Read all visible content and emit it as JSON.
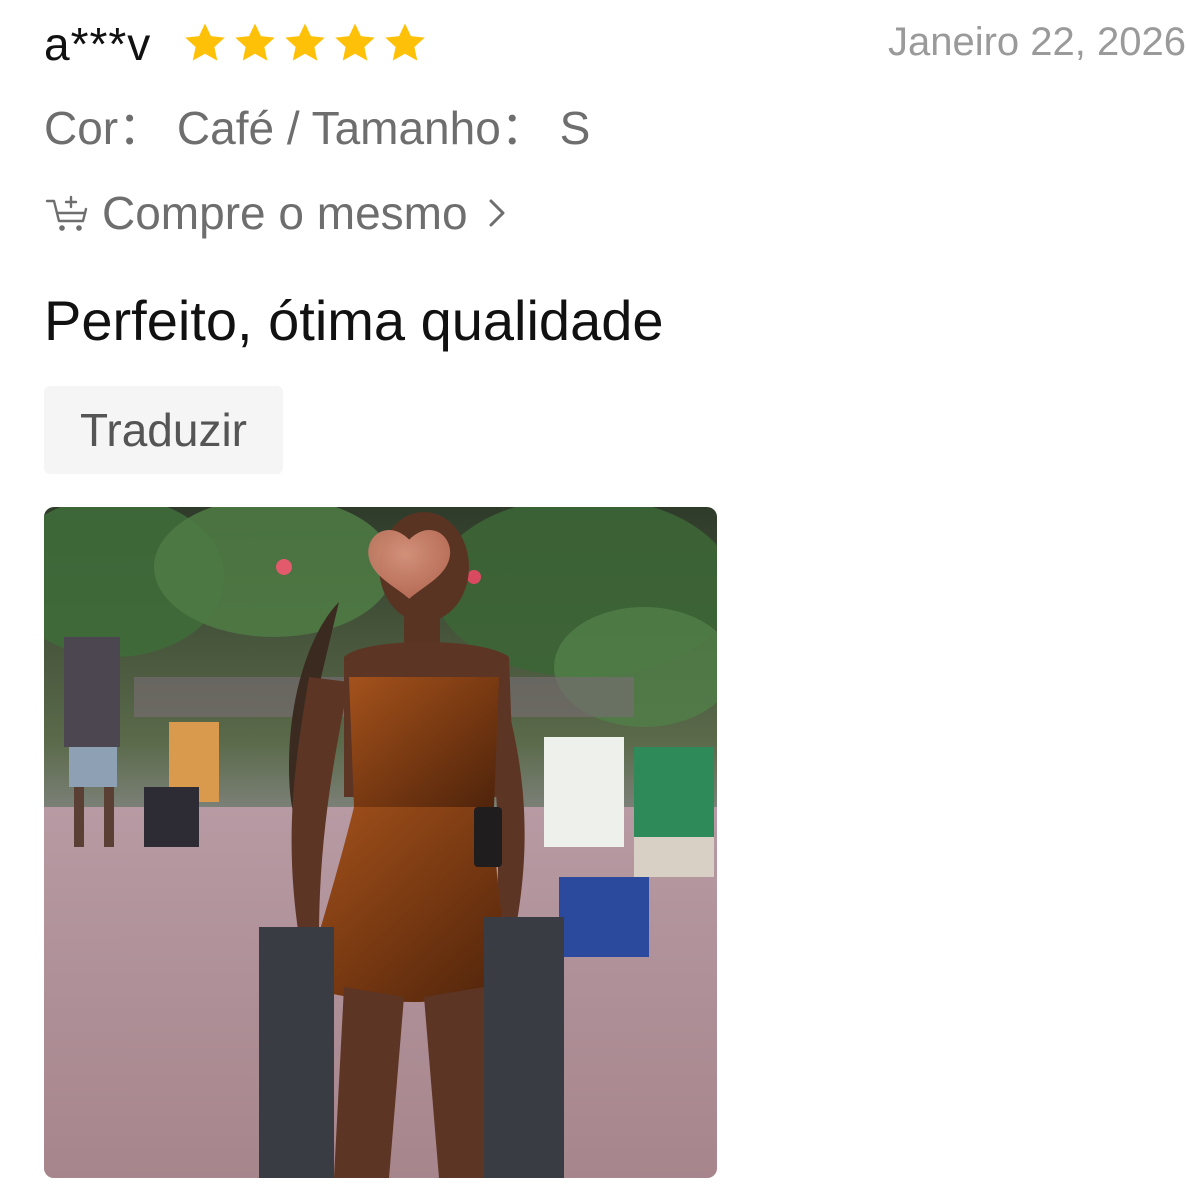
{
  "review": {
    "username": "a***v",
    "rating": 5,
    "rating_max": 5,
    "date": "Janeiro 22,  2026",
    "variant": "Cor： Café / Tamanho： S",
    "buy_same_label": "Compre o mesmo",
    "text": "Perfeito,  ótima qualidade",
    "translate_label": "Traduzir",
    "photo_icon": "face-covered-by-heart-emoji"
  },
  "colors": {
    "star": "#FFC107",
    "secondary_text": "#6E6E6E",
    "date_text": "#9A9A9A",
    "primary_text": "#111111",
    "translate_bg": "#F5F5F5"
  },
  "icons": {
    "rating": "star-icon",
    "buy_same": "cart-plus-icon",
    "chevron": "chevron-right-icon"
  }
}
